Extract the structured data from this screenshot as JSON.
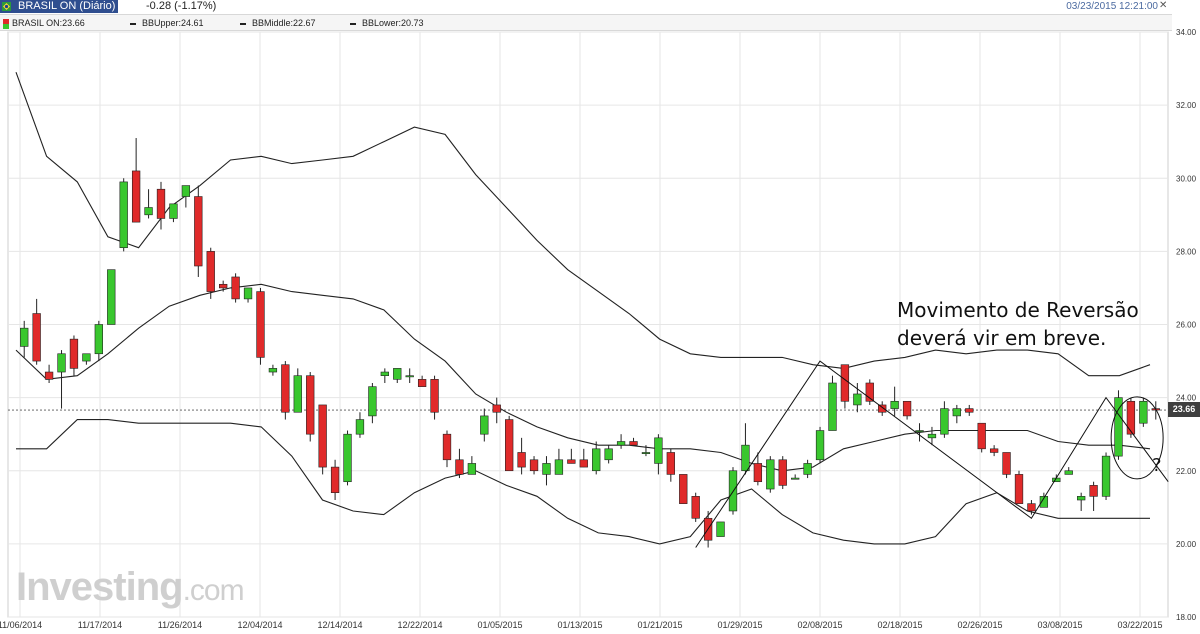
{
  "header": {
    "title": "BRASIL ON (Diário)",
    "change": "-0.28 (-1.17%)",
    "datetime": "03/23/2015 12:21:00"
  },
  "legend": {
    "symbol": "BRASIL ON:23.66",
    "bb_upper": "BBUpper:24.61",
    "bb_middle": "BBMiddle:22.67",
    "bb_lower": "BBLower:20.73"
  },
  "price_tag": "23.66",
  "annotation": {
    "line1": "Movimento de Reversão",
    "line2": "deverá vir em breve.",
    "question": "?"
  },
  "watermark": {
    "brand": "Investing",
    "suffix": ".com"
  },
  "colors": {
    "up": "#39c72e",
    "down": "#e02a2a",
    "band": "#222222",
    "grid": "#e6e6e6",
    "header_bg": "#2f4e8f"
  },
  "chart_data": {
    "type": "candlestick",
    "ylim": [
      18,
      34
    ],
    "y_ticks": [
      "18.00",
      "20.00",
      "22.00",
      "24.00",
      "26.00",
      "28.00",
      "30.00",
      "32.00",
      "34.00"
    ],
    "x_ticks": [
      "11/06/2014",
      "11/17/2014",
      "11/26/2014",
      "12/04/2014",
      "12/14/2014",
      "12/22/2014",
      "01/05/2015",
      "01/13/2015",
      "01/21/2015",
      "01/29/2015",
      "02/08/2015",
      "02/18/2015",
      "02/26/2015",
      "03/08/2015",
      "03/22/2015"
    ],
    "last_price": 23.66,
    "candles": [
      {
        "o": 25.4,
        "h": 26.1,
        "l": 25.1,
        "c": 25.9
      },
      {
        "o": 26.3,
        "h": 26.7,
        "l": 24.9,
        "c": 25.0
      },
      {
        "o": 24.7,
        "h": 24.9,
        "l": 24.4,
        "c": 24.5
      },
      {
        "o": 24.7,
        "h": 25.3,
        "l": 23.7,
        "c": 25.2
      },
      {
        "o": 25.6,
        "h": 25.7,
        "l": 24.6,
        "c": 24.8
      },
      {
        "o": 25.0,
        "h": 25.2,
        "l": 24.9,
        "c": 25.2
      },
      {
        "o": 25.2,
        "h": 26.1,
        "l": 25.0,
        "c": 26.0
      },
      {
        "o": 26.0,
        "h": 27.5,
        "l": 26.0,
        "c": 27.5
      },
      {
        "o": 28.1,
        "h": 30.0,
        "l": 28.0,
        "c": 29.9
      },
      {
        "o": 30.2,
        "h": 31.1,
        "l": 28.8,
        "c": 28.8
      },
      {
        "o": 29.0,
        "h": 29.7,
        "l": 28.9,
        "c": 29.2
      },
      {
        "o": 29.7,
        "h": 29.9,
        "l": 28.6,
        "c": 28.9
      },
      {
        "o": 28.9,
        "h": 29.3,
        "l": 28.8,
        "c": 29.3
      },
      {
        "o": 29.5,
        "h": 29.8,
        "l": 29.2,
        "c": 29.8
      },
      {
        "o": 29.5,
        "h": 29.8,
        "l": 27.3,
        "c": 27.6
      },
      {
        "o": 28.0,
        "h": 28.1,
        "l": 26.7,
        "c": 26.9
      },
      {
        "o": 27.1,
        "h": 27.2,
        "l": 26.9,
        "c": 27.0
      },
      {
        "o": 27.3,
        "h": 27.4,
        "l": 26.6,
        "c": 26.7
      },
      {
        "o": 26.7,
        "h": 27.0,
        "l": 26.6,
        "c": 27.0
      },
      {
        "o": 26.9,
        "h": 27.0,
        "l": 24.9,
        "c": 25.1
      },
      {
        "o": 24.7,
        "h": 24.9,
        "l": 24.6,
        "c": 24.8
      },
      {
        "o": 24.9,
        "h": 25.0,
        "l": 23.4,
        "c": 23.6
      },
      {
        "o": 23.6,
        "h": 24.8,
        "l": 23.6,
        "c": 24.6
      },
      {
        "o": 24.6,
        "h": 24.7,
        "l": 22.8,
        "c": 23.0
      },
      {
        "o": 23.8,
        "h": 23.8,
        "l": 21.9,
        "c": 22.1
      },
      {
        "o": 22.1,
        "h": 22.3,
        "l": 21.2,
        "c": 21.4
      },
      {
        "o": 21.7,
        "h": 23.1,
        "l": 21.6,
        "c": 23.0
      },
      {
        "o": 23.0,
        "h": 23.6,
        "l": 22.9,
        "c": 23.4
      },
      {
        "o": 23.5,
        "h": 24.4,
        "l": 23.3,
        "c": 24.3
      },
      {
        "o": 24.6,
        "h": 24.8,
        "l": 24.4,
        "c": 24.7
      },
      {
        "o": 24.5,
        "h": 24.8,
        "l": 24.4,
        "c": 24.8
      },
      {
        "o": 24.6,
        "h": 24.8,
        "l": 24.4,
        "c": 24.6
      },
      {
        "o": 24.5,
        "h": 24.6,
        "l": 24.3,
        "c": 24.3
      },
      {
        "o": 24.5,
        "h": 24.6,
        "l": 23.4,
        "c": 23.6
      },
      {
        "o": 23.0,
        "h": 23.1,
        "l": 22.1,
        "c": 22.3
      },
      {
        "o": 22.3,
        "h": 22.6,
        "l": 21.8,
        "c": 21.9
      },
      {
        "o": 21.9,
        "h": 22.4,
        "l": 21.9,
        "c": 22.2
      },
      {
        "o": 23.0,
        "h": 23.7,
        "l": 22.8,
        "c": 23.5
      },
      {
        "o": 23.8,
        "h": 24.0,
        "l": 23.3,
        "c": 23.6
      },
      {
        "o": 23.4,
        "h": 23.5,
        "l": 22.0,
        "c": 22.0
      },
      {
        "o": 22.5,
        "h": 22.9,
        "l": 21.9,
        "c": 22.1
      },
      {
        "o": 22.3,
        "h": 22.4,
        "l": 21.9,
        "c": 22.0
      },
      {
        "o": 21.9,
        "h": 22.4,
        "l": 21.6,
        "c": 22.2
      },
      {
        "o": 21.9,
        "h": 22.6,
        "l": 21.9,
        "c": 22.3
      },
      {
        "o": 22.3,
        "h": 22.6,
        "l": 22.2,
        "c": 22.2
      },
      {
        "o": 22.3,
        "h": 22.6,
        "l": 22.1,
        "c": 22.1
      },
      {
        "o": 22.0,
        "h": 22.8,
        "l": 21.9,
        "c": 22.6
      },
      {
        "o": 22.3,
        "h": 22.7,
        "l": 22.2,
        "c": 22.6
      },
      {
        "o": 22.7,
        "h": 23.0,
        "l": 22.6,
        "c": 22.8
      },
      {
        "o": 22.8,
        "h": 22.9,
        "l": 22.7,
        "c": 22.7
      },
      {
        "o": 22.5,
        "h": 22.7,
        "l": 22.4,
        "c": 22.5
      },
      {
        "o": 22.2,
        "h": 23.0,
        "l": 21.9,
        "c": 22.9
      },
      {
        "o": 22.5,
        "h": 22.6,
        "l": 21.7,
        "c": 21.9
      },
      {
        "o": 21.9,
        "h": 21.9,
        "l": 21.1,
        "c": 21.1
      },
      {
        "o": 21.3,
        "h": 21.4,
        "l": 20.6,
        "c": 20.7
      },
      {
        "o": 20.7,
        "h": 20.9,
        "l": 19.9,
        "c": 20.1
      },
      {
        "o": 20.2,
        "h": 20.6,
        "l": 20.2,
        "c": 20.6
      },
      {
        "o": 20.9,
        "h": 22.1,
        "l": 20.8,
        "c": 22.0
      },
      {
        "o": 22.0,
        "h": 23.3,
        "l": 21.9,
        "c": 22.7
      },
      {
        "o": 22.2,
        "h": 22.5,
        "l": 21.6,
        "c": 21.7
      },
      {
        "o": 21.5,
        "h": 22.4,
        "l": 21.4,
        "c": 22.3
      },
      {
        "o": 22.3,
        "h": 22.4,
        "l": 21.5,
        "c": 21.6
      },
      {
        "o": 21.8,
        "h": 21.9,
        "l": 21.8,
        "c": 21.8
      },
      {
        "o": 21.9,
        "h": 22.3,
        "l": 21.8,
        "c": 22.2
      },
      {
        "o": 22.3,
        "h": 23.2,
        "l": 22.2,
        "c": 23.1
      },
      {
        "o": 23.1,
        "h": 24.6,
        "l": 23.1,
        "c": 24.4
      },
      {
        "o": 24.9,
        "h": 24.9,
        "l": 23.7,
        "c": 23.9
      },
      {
        "o": 23.8,
        "h": 24.4,
        "l": 23.6,
        "c": 24.1
      },
      {
        "o": 24.4,
        "h": 24.5,
        "l": 23.8,
        "c": 23.9
      },
      {
        "o": 23.8,
        "h": 23.9,
        "l": 23.5,
        "c": 23.6
      },
      {
        "o": 23.7,
        "h": 24.3,
        "l": 23.5,
        "c": 23.9
      },
      {
        "o": 23.9,
        "h": 23.9,
        "l": 23.4,
        "c": 23.5
      },
      {
        "o": 23.1,
        "h": 23.3,
        "l": 22.8,
        "c": 23.1
      },
      {
        "o": 22.9,
        "h": 23.2,
        "l": 22.7,
        "c": 23.0
      },
      {
        "o": 23.0,
        "h": 23.9,
        "l": 22.9,
        "c": 23.7
      },
      {
        "o": 23.5,
        "h": 23.8,
        "l": 23.3,
        "c": 23.7
      },
      {
        "o": 23.7,
        "h": 23.8,
        "l": 23.5,
        "c": 23.6
      },
      {
        "o": 23.3,
        "h": 23.3,
        "l": 22.5,
        "c": 22.6
      },
      {
        "o": 22.6,
        "h": 22.7,
        "l": 22.4,
        "c": 22.5
      },
      {
        "o": 22.5,
        "h": 22.5,
        "l": 21.8,
        "c": 21.9
      },
      {
        "o": 21.9,
        "h": 22.0,
        "l": 21.1,
        "c": 21.1
      },
      {
        "o": 21.1,
        "h": 21.2,
        "l": 20.8,
        "c": 20.9
      },
      {
        "o": 21.0,
        "h": 21.4,
        "l": 21.0,
        "c": 21.3
      },
      {
        "o": 21.7,
        "h": 21.9,
        "l": 21.7,
        "c": 21.8
      },
      {
        "o": 21.9,
        "h": 22.1,
        "l": 21.9,
        "c": 22.0
      },
      {
        "o": 21.2,
        "h": 21.4,
        "l": 20.9,
        "c": 21.3
      },
      {
        "o": 21.6,
        "h": 21.7,
        "l": 20.9,
        "c": 21.3
      },
      {
        "o": 21.3,
        "h": 22.5,
        "l": 21.2,
        "c": 22.4
      },
      {
        "o": 22.4,
        "h": 24.2,
        "l": 22.3,
        "c": 24.0
      },
      {
        "o": 23.9,
        "h": 24.0,
        "l": 22.9,
        "c": 23.0
      },
      {
        "o": 23.3,
        "h": 24.0,
        "l": 23.2,
        "c": 23.9
      },
      {
        "o": 23.7,
        "h": 23.9,
        "l": 23.4,
        "c": 23.66
      }
    ],
    "bb_upper": [
      32.9,
      30.6,
      29.9,
      28.4,
      28.1,
      29.2,
      29.8,
      30.5,
      30.6,
      30.4,
      30.5,
      30.6,
      31.0,
      31.4,
      31.2,
      30.1,
      29.2,
      28.3,
      27.5,
      26.9,
      26.3,
      25.6,
      25.2,
      25.1,
      25.1,
      25.1,
      24.9,
      24.8,
      25.0,
      25.1,
      25.3,
      25.2,
      25.3,
      25.3,
      25.2,
      24.6,
      24.6,
      24.9
    ],
    "bb_middle": [
      25.3,
      24.5,
      24.6,
      25.2,
      25.9,
      26.5,
      26.8,
      27.0,
      27.1,
      26.9,
      26.8,
      26.7,
      26.4,
      25.6,
      25.0,
      24.1,
      23.6,
      23.2,
      22.9,
      22.7,
      22.7,
      22.6,
      22.6,
      22.5,
      22.2,
      22.0,
      22.1,
      22.6,
      22.8,
      23.0,
      23.1,
      23.1,
      23.1,
      23.1,
      22.8,
      22.7,
      22.7,
      22.6
    ],
    "bb_lower": [
      22.6,
      22.6,
      23.4,
      23.4,
      23.3,
      23.3,
      23.3,
      23.3,
      23.2,
      22.4,
      21.2,
      20.9,
      20.8,
      21.4,
      21.8,
      22.0,
      21.6,
      21.3,
      20.7,
      20.3,
      20.2,
      20.0,
      20.2,
      21.2,
      21.5,
      20.8,
      20.3,
      20.1,
      20.0,
      20.0,
      20.2,
      21.1,
      21.4,
      20.9,
      20.7,
      20.7,
      20.7,
      20.7
    ]
  }
}
